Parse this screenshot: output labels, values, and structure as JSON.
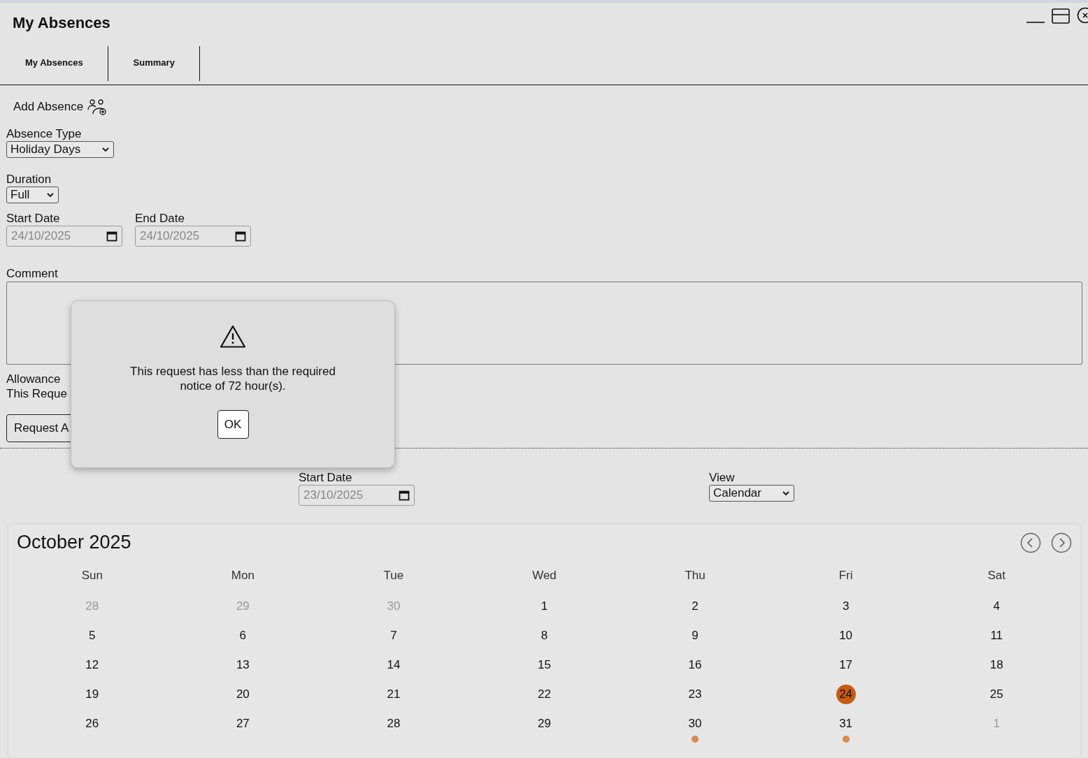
{
  "window": {
    "title": "My Absences"
  },
  "tabs": [
    {
      "label": "My Absences"
    },
    {
      "label": "Summary"
    }
  ],
  "form": {
    "heading": "Add Absence",
    "absence_type": {
      "label": "Absence Type",
      "value": "Holiday Days"
    },
    "duration": {
      "label": "Duration",
      "value": "Full"
    },
    "start_date": {
      "label": "Start Date",
      "value": "24/10/2025"
    },
    "end_date": {
      "label": "End Date",
      "value": "24/10/2025"
    },
    "comment": {
      "label": "Comment"
    },
    "allowance_lines": [
      "Allowance",
      "This Reque"
    ],
    "submit_button": "Request A"
  },
  "filters": {
    "start_date": {
      "label": "Start Date",
      "value": "23/10/2025"
    },
    "view": {
      "label": "View",
      "value": "Calendar"
    }
  },
  "calendar": {
    "title": "October 2025",
    "weekdays": [
      "Sun",
      "Mon",
      "Tue",
      "Wed",
      "Thu",
      "Fri",
      "Sat"
    ],
    "weeks": [
      [
        {
          "day": "28",
          "muted": true,
          "selected": false,
          "event": false
        },
        {
          "day": "29",
          "muted": true,
          "selected": false,
          "event": false
        },
        {
          "day": "30",
          "muted": true,
          "selected": false,
          "event": false
        },
        {
          "day": "1",
          "muted": false,
          "selected": false,
          "event": false
        },
        {
          "day": "2",
          "muted": false,
          "selected": false,
          "event": false
        },
        {
          "day": "3",
          "muted": false,
          "selected": false,
          "event": false
        },
        {
          "day": "4",
          "muted": false,
          "selected": false,
          "event": false
        }
      ],
      [
        {
          "day": "5",
          "muted": false,
          "selected": false,
          "event": false
        },
        {
          "day": "6",
          "muted": false,
          "selected": false,
          "event": false
        },
        {
          "day": "7",
          "muted": false,
          "selected": false,
          "event": false
        },
        {
          "day": "8",
          "muted": false,
          "selected": false,
          "event": false
        },
        {
          "day": "9",
          "muted": false,
          "selected": false,
          "event": false
        },
        {
          "day": "10",
          "muted": false,
          "selected": false,
          "event": false
        },
        {
          "day": "11",
          "muted": false,
          "selected": false,
          "event": false
        }
      ],
      [
        {
          "day": "12",
          "muted": false,
          "selected": false,
          "event": false
        },
        {
          "day": "13",
          "muted": false,
          "selected": false,
          "event": false
        },
        {
          "day": "14",
          "muted": false,
          "selected": false,
          "event": false
        },
        {
          "day": "15",
          "muted": false,
          "selected": false,
          "event": false
        },
        {
          "day": "16",
          "muted": false,
          "selected": false,
          "event": false
        },
        {
          "day": "17",
          "muted": false,
          "selected": false,
          "event": false
        },
        {
          "day": "18",
          "muted": false,
          "selected": false,
          "event": false
        }
      ],
      [
        {
          "day": "19",
          "muted": false,
          "selected": false,
          "event": false
        },
        {
          "day": "20",
          "muted": false,
          "selected": false,
          "event": false
        },
        {
          "day": "21",
          "muted": false,
          "selected": false,
          "event": false
        },
        {
          "day": "22",
          "muted": false,
          "selected": false,
          "event": false
        },
        {
          "day": "23",
          "muted": false,
          "selected": false,
          "event": false
        },
        {
          "day": "24",
          "muted": false,
          "selected": true,
          "event": false
        },
        {
          "day": "25",
          "muted": false,
          "selected": false,
          "event": false
        }
      ],
      [
        {
          "day": "26",
          "muted": false,
          "selected": false,
          "event": false
        },
        {
          "day": "27",
          "muted": false,
          "selected": false,
          "event": false
        },
        {
          "day": "28",
          "muted": false,
          "selected": false,
          "event": false
        },
        {
          "day": "29",
          "muted": false,
          "selected": false,
          "event": false
        },
        {
          "day": "30",
          "muted": false,
          "selected": false,
          "event": true
        },
        {
          "day": "31",
          "muted": false,
          "selected": false,
          "event": true
        },
        {
          "day": "1",
          "muted": true,
          "selected": false,
          "event": false
        }
      ]
    ]
  },
  "dialog": {
    "message": "This request has less than the required notice of 72 hour(s).",
    "button": "OK"
  }
}
